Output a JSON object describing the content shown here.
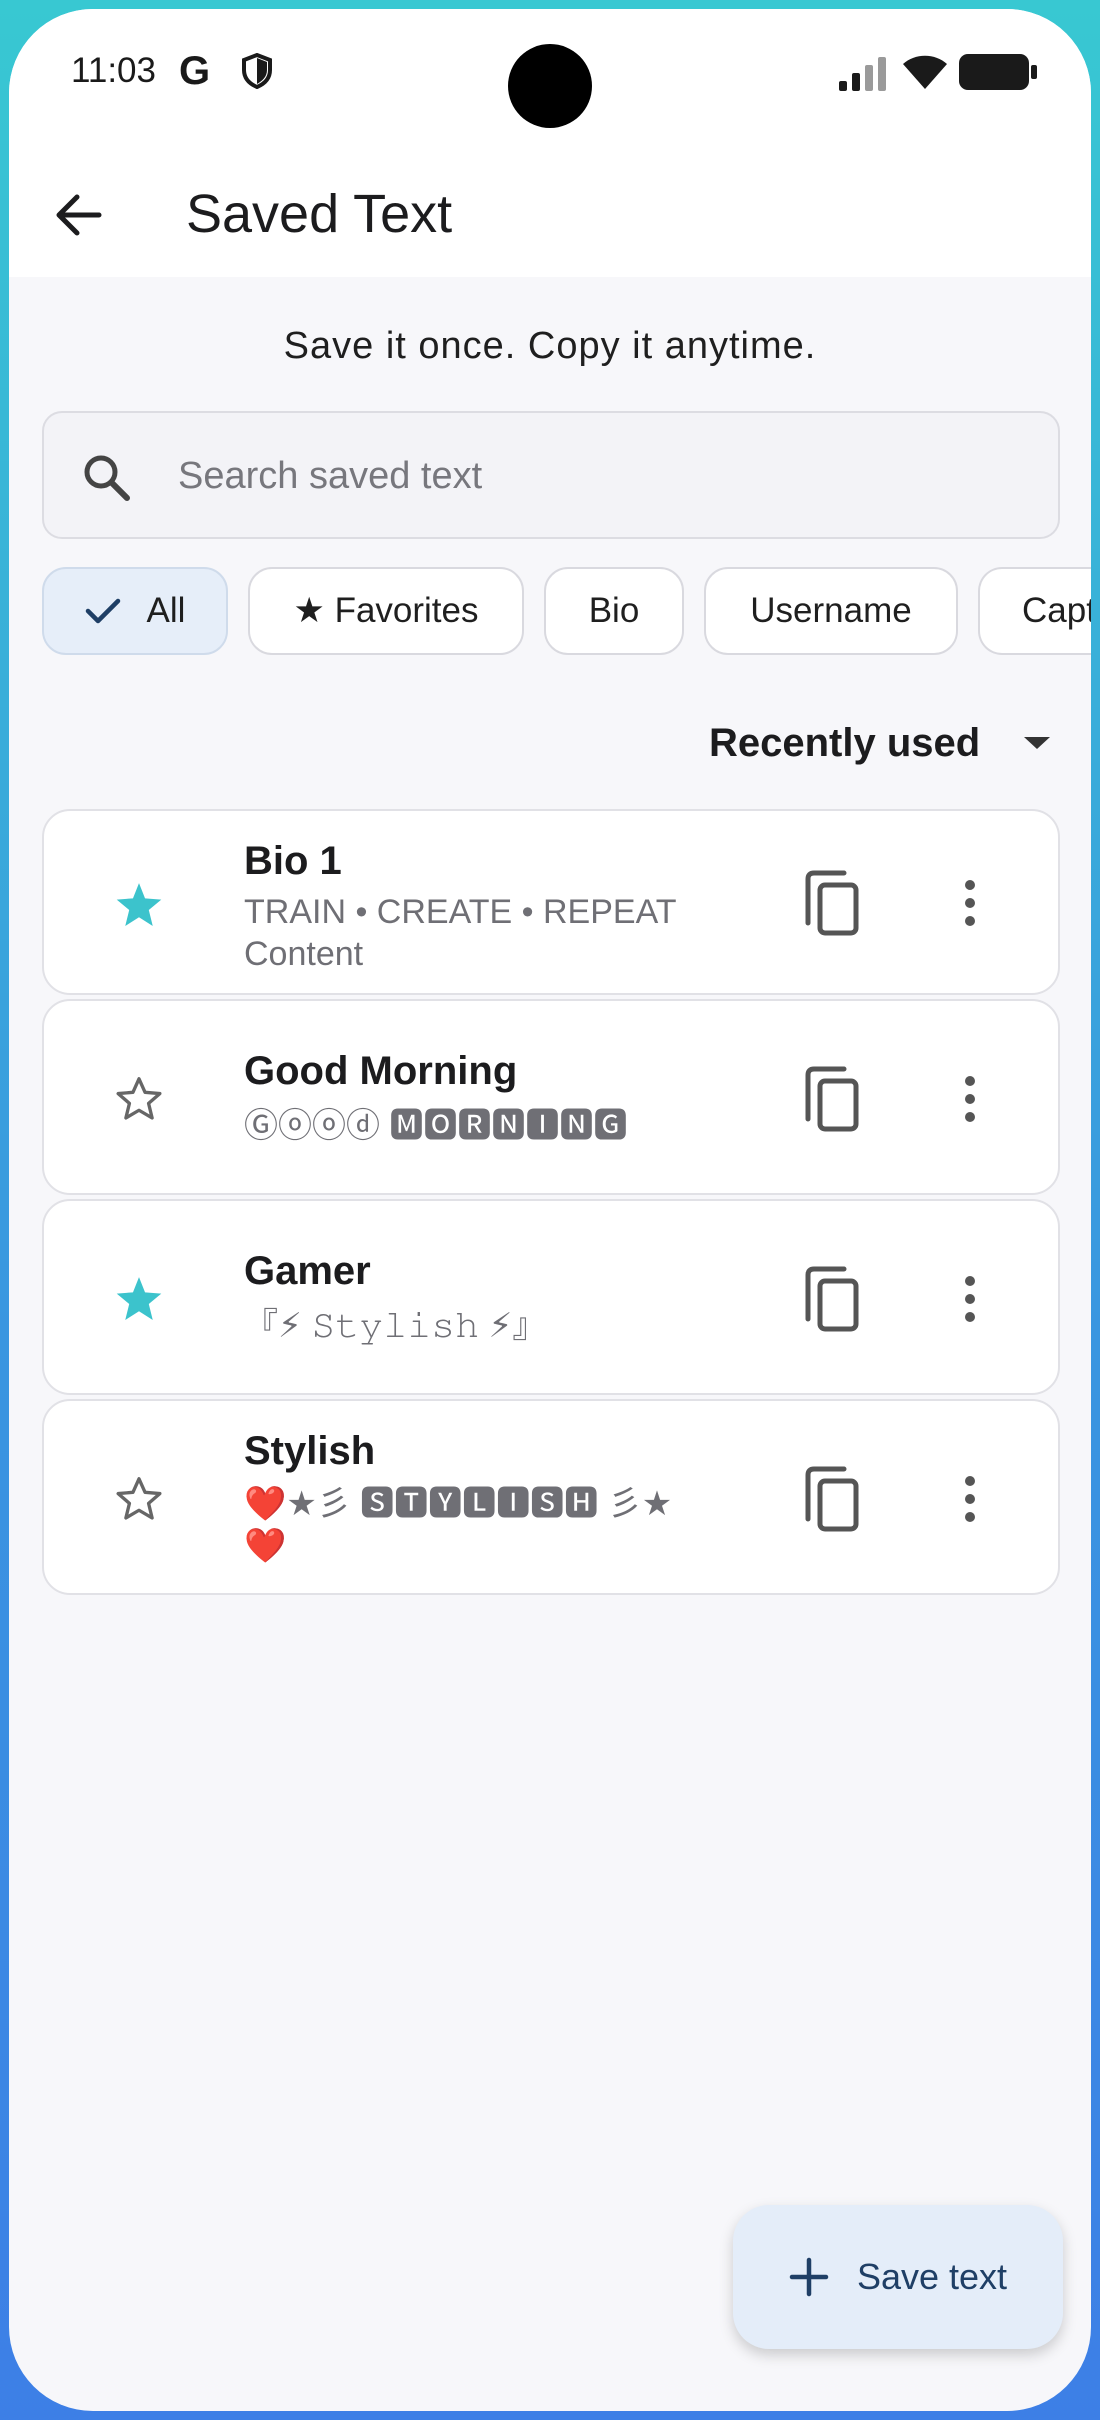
{
  "status_bar": {
    "time": "11:03",
    "g_glyph": "G"
  },
  "app_bar": {
    "title": "Saved Text"
  },
  "tagline": "Save it once. Copy it anytime.",
  "search": {
    "placeholder": "Search saved text",
    "value": ""
  },
  "filters": [
    {
      "label": "All",
      "selected": true
    },
    {
      "label": "★ Favorites",
      "selected": false
    },
    {
      "label": "Bio",
      "selected": false
    },
    {
      "label": "Username",
      "selected": false
    },
    {
      "label": "Capt",
      "selected": false
    }
  ],
  "sort": {
    "label": "Recently used"
  },
  "items": [
    {
      "title": "Bio 1",
      "preview": "TRAIN • CREATE • REPEAT Content",
      "favorite": true
    },
    {
      "title": "Good Morning",
      "preview": "Ⓖⓞⓞⓓ 🅼🅾🆁🅽🅸🅽🅶",
      "favorite": false
    },
    {
      "title": "Gamer",
      "preview": "『⚡ 𝚂𝚝𝚢𝚕𝚒𝚜𝚑 ⚡』",
      "favorite": true
    },
    {
      "title": "Stylish",
      "preview": "❤️★彡 🆂🆃🆈🅻🅸🆂🅷 彡★❤️",
      "favorite": false
    }
  ],
  "fab": {
    "label": "Save text"
  },
  "colors": {
    "accent": "#3cc3cc",
    "fab_bg": "#e4edf9",
    "chip_selected": "#e6eef9"
  }
}
